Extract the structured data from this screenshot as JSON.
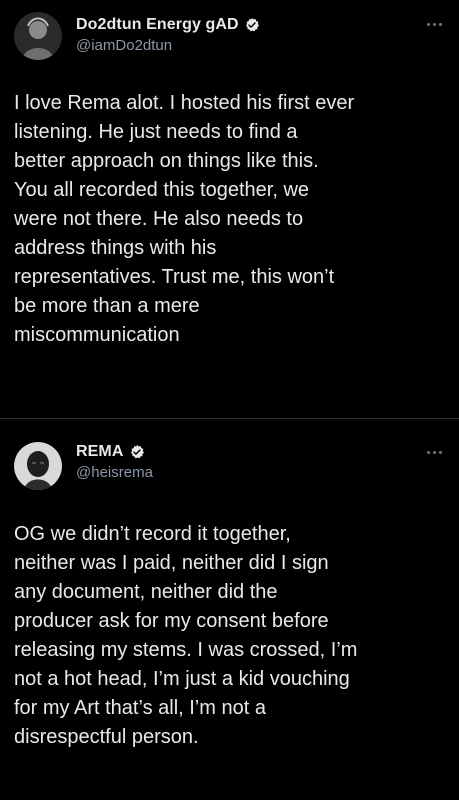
{
  "colors": {
    "background": "#000000",
    "text_primary": "#e7e9ea",
    "text_secondary": "#8b98a5",
    "divider": "#2f3336",
    "verified_badge": "#e7e9ea"
  },
  "tweets": [
    {
      "avatar_icon": "user-photo-avatar",
      "display_name": "Do2dtun Energy gAD",
      "handle": "@iamDo2dtun",
      "verified_icon": "verified-badge-icon",
      "more_icon": "more-options-icon",
      "text_lines": [
        "I love Rema alot. I hosted his first ever",
        "listening. He just needs to find a",
        "better approach on things like this.",
        "You all recorded this together, we",
        "were not there. He also needs to",
        "address things with his",
        "representatives. Trust me, this won’t",
        "be more than a mere",
        "miscommunication"
      ]
    },
    {
      "avatar_icon": "user-photo-avatar",
      "display_name": "REMA",
      "handle": "@heisrema",
      "verified_icon": "verified-badge-icon",
      "more_icon": "more-options-icon",
      "text_lines": [
        "OG we didn’t record it together,",
        "neither was I paid, neither did I sign",
        "any document, neither did the",
        "producer ask for my consent before",
        "releasing my stems. I was crossed, I’m",
        "not a hot head, I’m just a kid vouching",
        "for my Art that’s all, I’m not a",
        "disrespectful person."
      ]
    }
  ]
}
